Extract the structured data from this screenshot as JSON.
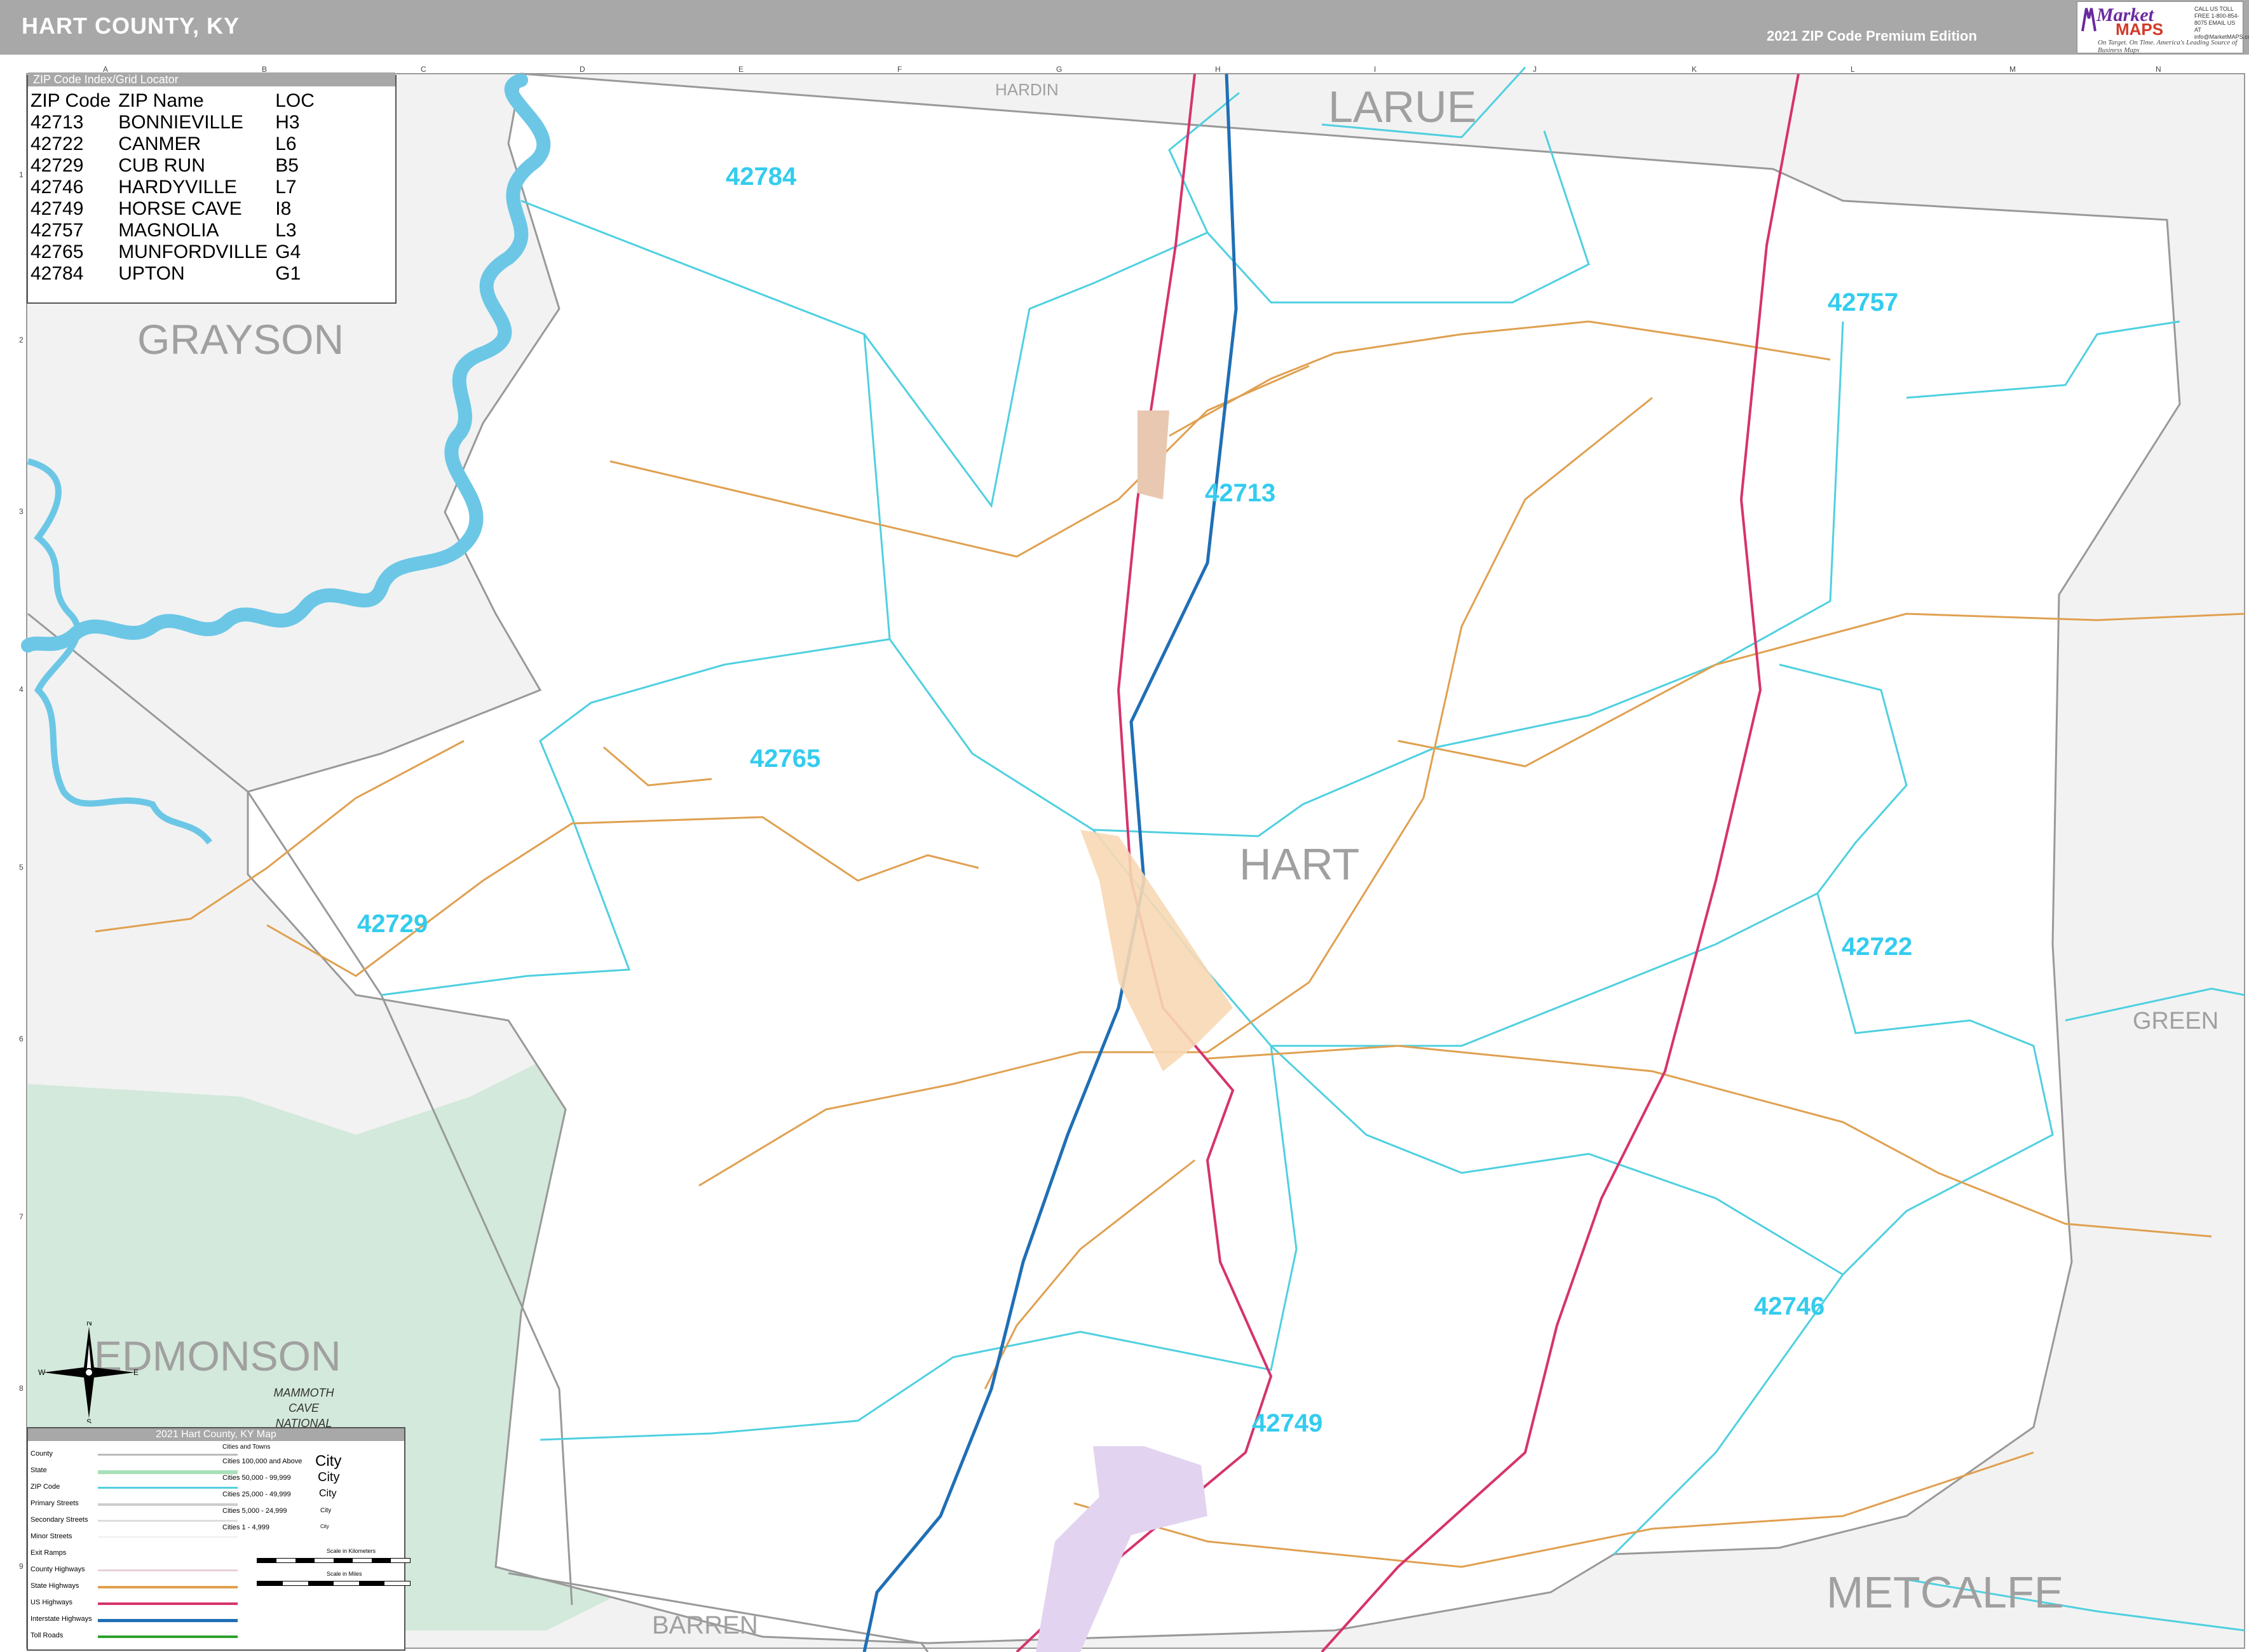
{
  "header": {
    "title": "HART COUNTY, KY",
    "edition": "2021 ZIP Code Premium Edition"
  },
  "logo": {
    "brand": "Market",
    "maps": "MAPS",
    "tagline": "On Target. On Time. America's Leading Source of Business Maps",
    "phone": "CALL US TOLL FREE 1-800-854-8075 EMAIL US AT info@MarketMAPS.com"
  },
  "index": {
    "title": "ZIP Code Index/Grid Locator",
    "columns": [
      "ZIP Code",
      "ZIP Name",
      "LOC"
    ],
    "rows": [
      [
        "42713",
        "BONNIEVILLE",
        "H3"
      ],
      [
        "42722",
        "CANMER",
        "L6"
      ],
      [
        "42729",
        "CUB RUN",
        "B5"
      ],
      [
        "42746",
        "HARDYVILLE",
        "L7"
      ],
      [
        "42749",
        "HORSE CAVE",
        "I8"
      ],
      [
        "42757",
        "MAGNOLIA",
        "L3"
      ],
      [
        "42765",
        "MUNFORDVILLE",
        "G4"
      ],
      [
        "42784",
        "UPTON",
        "G1"
      ]
    ]
  },
  "grid": {
    "columns": [
      "A",
      "B",
      "C",
      "D",
      "E",
      "F",
      "G",
      "H",
      "I",
      "J",
      "K",
      "L",
      "M",
      "N"
    ],
    "rows": [
      "1",
      "2",
      "3",
      "4",
      "5",
      "6",
      "7",
      "8",
      "9"
    ]
  },
  "counties": {
    "main": "HART",
    "neighbors": [
      "LARUE",
      "GRAYSON",
      "EDMONSON",
      "BARREN",
      "METCALFE",
      "GREEN",
      "HARDIN"
    ]
  },
  "zip_labels": [
    "42784",
    "42757",
    "42713",
    "42765",
    "42729",
    "42722",
    "42746",
    "42749"
  ],
  "park_label": [
    "MAMMOTH",
    "CAVE",
    "NATIONAL"
  ],
  "compass": {
    "n": "N",
    "s": "S",
    "e": "E",
    "w": "W"
  },
  "legend": {
    "title": "2021 Hart County, KY Map",
    "items": [
      "County",
      "State",
      "ZIP Code",
      "Primary Streets",
      "Secondary Streets",
      "Minor Streets",
      "Exit Ramps",
      "County Highways",
      "State Highways",
      "US Highways",
      "Interstate Highways",
      "Toll Roads"
    ],
    "cities_title": "Cities and Towns",
    "cities": [
      "Cities 100,000 and Above",
      "Cities 50,000 - 99,999",
      "Cities 25,000 - 49,999",
      "Cities 5,000 - 24,999",
      "Cities 1 - 4,999"
    ],
    "city_samples": [
      "City",
      "City",
      "City",
      "City",
      "City"
    ],
    "scale_km": "Scale in Kilometers",
    "scale_mi": "Scale in Miles"
  },
  "colors": {
    "header": "#a8a8a8",
    "zip_boundary": "#4fd0e0",
    "zip_label": "#33ccee",
    "county_label": "#a0a0a0",
    "interstate": "#1f6fb5",
    "us_highway": "#d6336c",
    "state_highway": "#e0a050",
    "water": "#6cc7e6",
    "park": "#cfe8d8",
    "city_munfordville": "#f7d8b4",
    "city_horse_cave": "#e2d4f0",
    "outside": "#f2f2f2"
  }
}
